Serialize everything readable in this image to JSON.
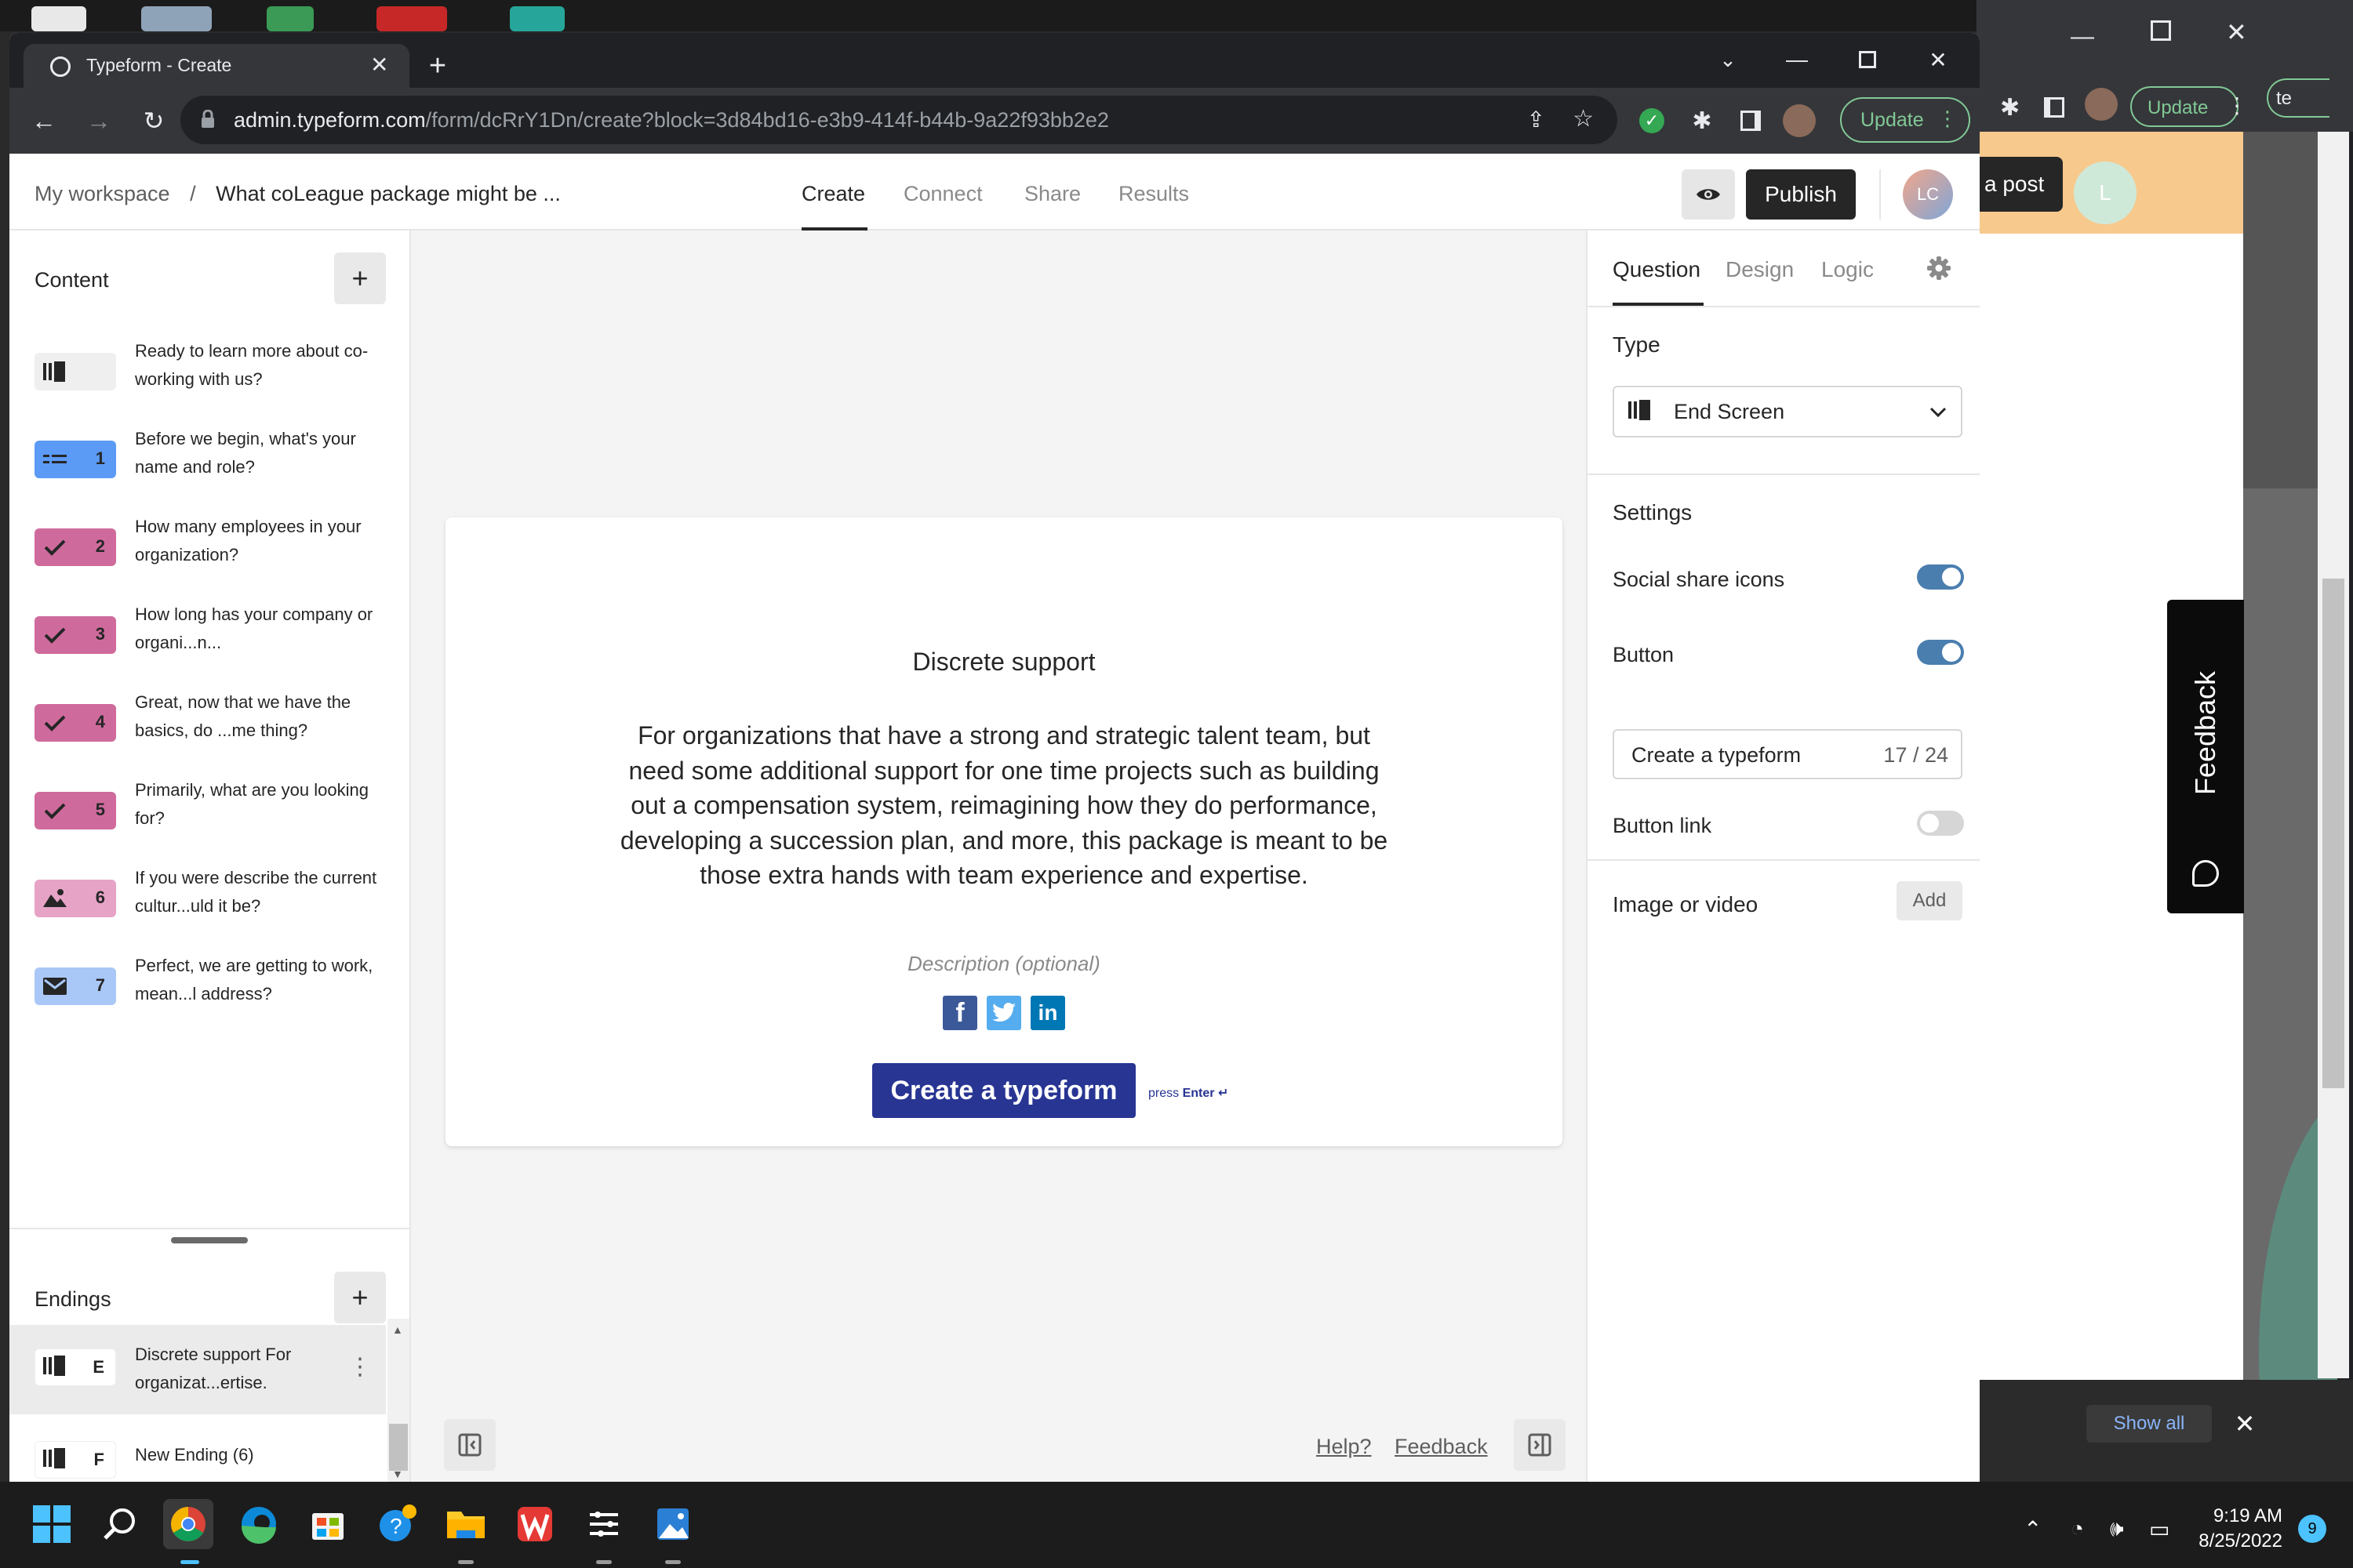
{
  "browser": {
    "tab_title": "Typeform - Create",
    "url_host": "admin.typeform.com",
    "url_path": "/form/dcRrY1Dn/create?block=3d84bd16-e3b9-414f-b44b-9a22f93bb2e2",
    "update_label": "Update"
  },
  "header": {
    "workspace": "My workspace",
    "separator": "/",
    "form_title": "What coLeague package might be ...",
    "tabs": [
      "Create",
      "Connect",
      "Share",
      "Results"
    ],
    "active_tab": "Create",
    "publish_label": "Publish",
    "avatar_initials": "LC"
  },
  "sidebar": {
    "content_label": "Content",
    "add_label": "+",
    "items": [
      {
        "number": "",
        "type": "welcome",
        "color": "#efefef",
        "text": "Ready to learn more about co-working with us?"
      },
      {
        "number": "1",
        "type": "contact",
        "color": "#5b9bf5",
        "text": "Before we begin, what's your name and role?"
      },
      {
        "number": "2",
        "type": "check",
        "color": "#cf6b9c",
        "text": "How many employees in your organization?"
      },
      {
        "number": "3",
        "type": "check",
        "color": "#cf6b9c",
        "text": "How long has your company or organi...n..."
      },
      {
        "number": "4",
        "type": "check",
        "color": "#cf6b9c",
        "text": "Great, now that we have the basics, do ...me thing?"
      },
      {
        "number": "5",
        "type": "check",
        "color": "#cf6b9c",
        "text": "Primarily, what are you looking for?"
      },
      {
        "number": "6",
        "type": "picture",
        "color": "#e7a3c5",
        "text": "If you were describe the current cultur...uld it be?"
      },
      {
        "number": "7",
        "type": "email",
        "color": "#a9c8f7",
        "text": "Perfect, we are getting to work, mean...l address?"
      }
    ],
    "endings_label": "Endings",
    "endings": [
      {
        "letter": "E",
        "text": "Discrete support For organizat...ertise."
      },
      {
        "letter": "F",
        "text": "New Ending (6)"
      }
    ]
  },
  "canvas": {
    "title": "Discrete support",
    "description": "For organizations that have a strong and strategic talent team, but need some additional support for one time projects such as building out a compensation system, reimagining how they do performance, developing a succession plan, and more, this package is meant to be those extra hands with team experience and expertise.",
    "description_placeholder": "Description (optional)",
    "button_label": "Create a typeform",
    "hint_press": "press",
    "hint_key": "Enter ↵",
    "help_label": "Help?",
    "feedback_label": "Feedback"
  },
  "panel": {
    "tabs": [
      "Question",
      "Design",
      "Logic"
    ],
    "type_label": "Type",
    "type_value": "End Screen",
    "settings_label": "Settings",
    "social_share_label": "Social share icons",
    "social_share_on": true,
    "button_label": "Button",
    "button_on": true,
    "button_text": "Create a typeform",
    "button_count": "17 / 24",
    "button_link_label": "Button link",
    "button_link_on": false,
    "image_label": "Image or video",
    "add_label": "Add"
  },
  "background_window": {
    "post_label": "a post",
    "avatar_initial": "L",
    "update_label": "Update",
    "tab_fragment": "te",
    "feedback_label": "Feedback",
    "show_all_label": "Show all"
  },
  "taskbar": {
    "time": "9:19 AM",
    "date": "8/25/2022",
    "notification_count": "9"
  }
}
